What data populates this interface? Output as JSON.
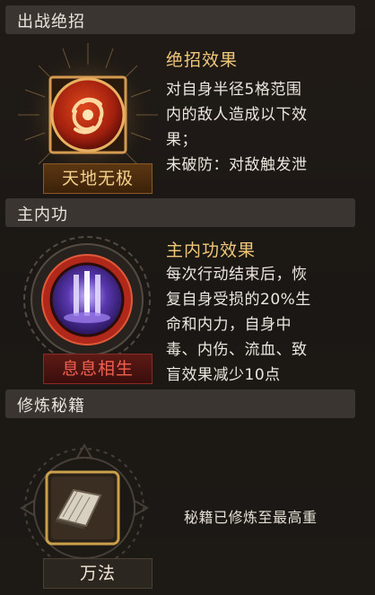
{
  "sections": {
    "ultimate": {
      "header": "出战绝招",
      "skill_name": "天地无极",
      "effect_title": "绝招效果",
      "effect_lines": [
        "对自身半径5格范围",
        "内的敌人造成以下效",
        "果；",
        "未破防：对敌触发泄"
      ]
    },
    "inner": {
      "header": "主内功",
      "skill_name": "息息相生",
      "effect_title": "主内功效果",
      "effect_lines": [
        "每次行动结束后，恢",
        "复自身受损的20%生",
        "命和内力，自身中",
        "毒、内伤、流血、致",
        "盲效果减少10点"
      ]
    },
    "manual": {
      "header": "修炼秘籍",
      "skill_name": "万法",
      "status": "秘籍已修炼至最高重"
    }
  },
  "colors": {
    "accent_gold": "#f0c87a",
    "ultimate_plate": "#4a2a10",
    "inner_plate": "#521816",
    "manual_plate": "#2b2620",
    "inner_name": "#f06050",
    "ultimate_name": "#f3d18a"
  },
  "icons": {
    "ultimate": "swirl-vortex-icon",
    "inner": "light-pillar-icon",
    "manual": "open-book-icon"
  }
}
